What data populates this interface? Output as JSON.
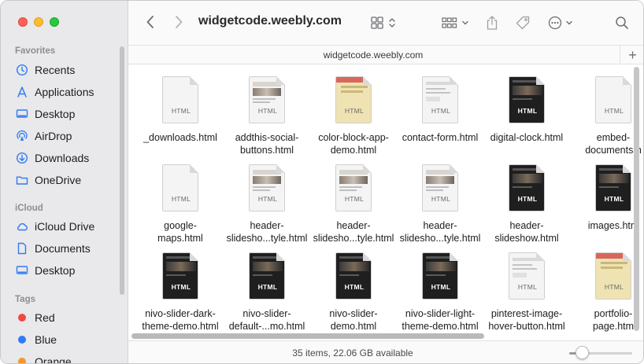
{
  "window": {
    "title": "widgetcode.weebly.com"
  },
  "sidebar": {
    "sections": [
      {
        "label": "Favorites"
      },
      {
        "label": "iCloud"
      },
      {
        "label": "Tags"
      }
    ],
    "favorites": [
      {
        "label": "Recents",
        "icon": "clock-icon"
      },
      {
        "label": "Applications",
        "icon": "applications-icon"
      },
      {
        "label": "Desktop",
        "icon": "desktop-icon"
      },
      {
        "label": "AirDrop",
        "icon": "airdrop-icon"
      },
      {
        "label": "Downloads",
        "icon": "downloads-icon"
      },
      {
        "label": "OneDrive",
        "icon": "folder-icon"
      }
    ],
    "icloud": [
      {
        "label": "iCloud Drive",
        "icon": "cloud-icon"
      },
      {
        "label": "Documents",
        "icon": "document-icon"
      },
      {
        "label": "Desktop",
        "icon": "desktop-icon"
      }
    ],
    "tags": [
      {
        "label": "Red",
        "color": "#ee4b45"
      },
      {
        "label": "Blue",
        "color": "#2f7bf5"
      },
      {
        "label": "Orange",
        "color": "#f39a2b"
      }
    ]
  },
  "pathbar": {
    "title": "widgetcode.weebly.com"
  },
  "files": [
    {
      "line1": "_downloads.html",
      "line2": "",
      "badge": "HTML",
      "style": "blank"
    },
    {
      "line1": "addthis-social-",
      "line2": "buttons.html",
      "badge": "HTML",
      "style": "site"
    },
    {
      "line1": "color-block-app-",
      "line2": "demo.html",
      "badge": "HTML",
      "style": "color"
    },
    {
      "line1": "contact-form.html",
      "line2": "",
      "badge": "HTML",
      "style": "light"
    },
    {
      "line1": "digital-clock.html",
      "line2": "",
      "badge": "HTML",
      "style": "dark"
    },
    {
      "line1": "embed-",
      "line2": "documents.h",
      "badge": "HTML",
      "style": "blank"
    },
    {
      "line1": "google-",
      "line2": "maps.html",
      "badge": "HTML",
      "style": "blank"
    },
    {
      "line1": "header-",
      "line2": "slidesho...tyle.html",
      "badge": "HTML",
      "style": "site"
    },
    {
      "line1": "header-",
      "line2": "slidesho...tyle.html",
      "badge": "HTML",
      "style": "site"
    },
    {
      "line1": "header-",
      "line2": "slidesho...tyle.html",
      "badge": "HTML",
      "style": "site"
    },
    {
      "line1": "header-",
      "line2": "slideshow.html",
      "badge": "HTML",
      "style": "dark"
    },
    {
      "line1": "images.htm",
      "line2": "",
      "badge": "HTML",
      "style": "dark"
    },
    {
      "line1": "nivo-slider-dark-",
      "line2": "theme-demo.html",
      "badge": "HTML",
      "style": "dark"
    },
    {
      "line1": "nivo-slider-",
      "line2": "default-...mo.html",
      "badge": "HTML",
      "style": "dark"
    },
    {
      "line1": "nivo-slider-",
      "line2": "demo.html",
      "badge": "HTML",
      "style": "dark"
    },
    {
      "line1": "nivo-slider-light-",
      "line2": "theme-demo.html",
      "badge": "HTML",
      "style": "dark"
    },
    {
      "line1": "pinterest-image-",
      "line2": "hover-button.html",
      "badge": "HTML",
      "style": "light"
    },
    {
      "line1": "portfolio-",
      "line2": "page.htm",
      "badge": "HTML",
      "style": "color"
    }
  ],
  "status": {
    "text": "35 items, 22.06 GB available",
    "zoom_fraction": 0.2
  }
}
